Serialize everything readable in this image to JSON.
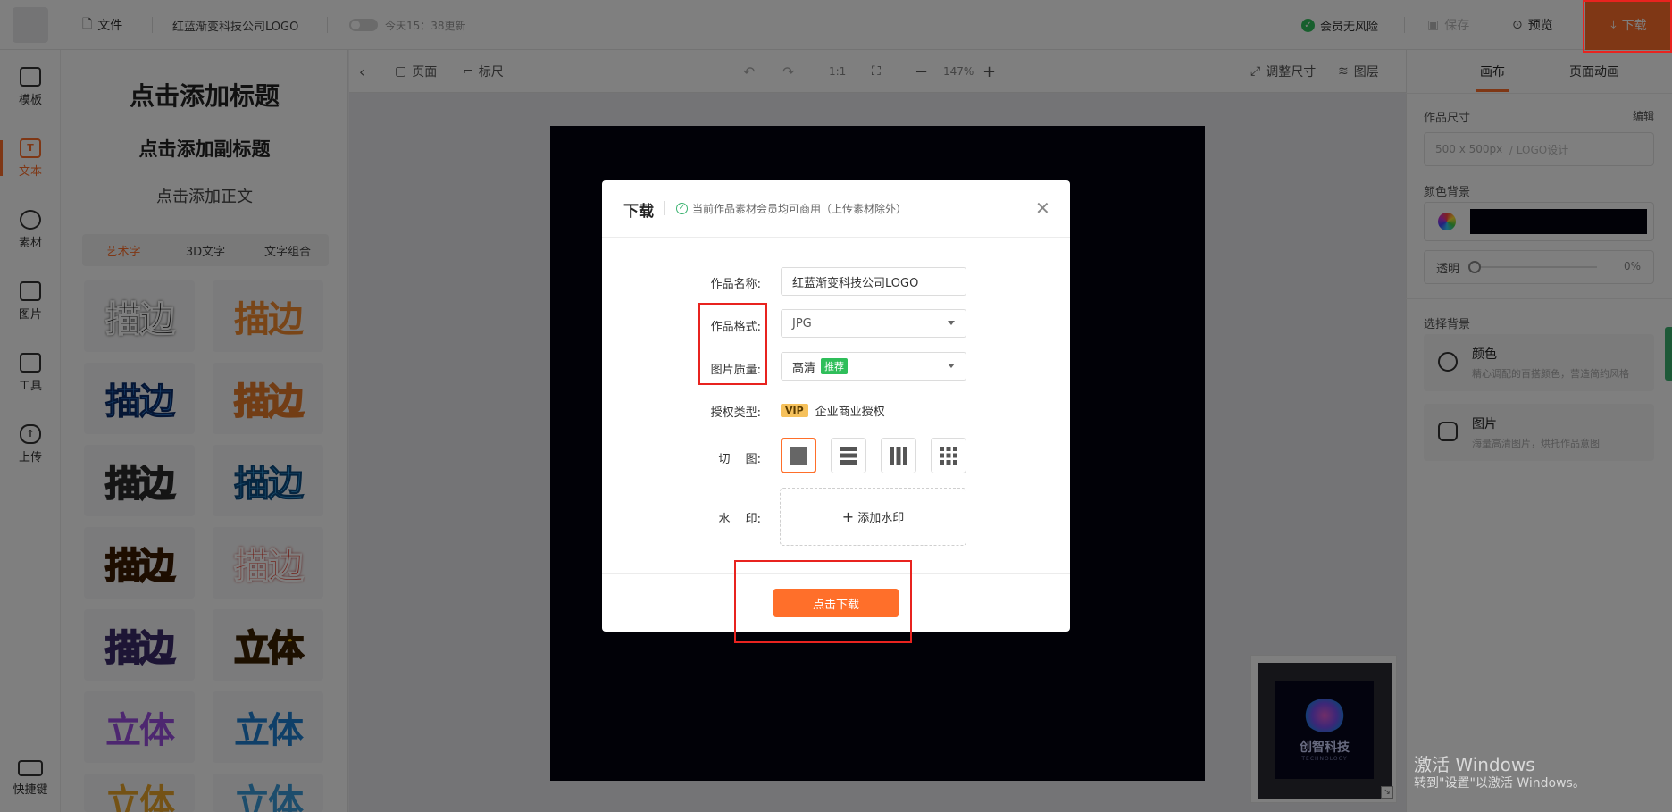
{
  "header": {
    "file_label": "文件",
    "doc_title": "红蓝渐变科技公司LOGO",
    "update_time": "今天15：38更新",
    "member_status": "会员无风险",
    "save_label": "保存",
    "preview_label": "预览",
    "download_label": "下载"
  },
  "rail": {
    "items": [
      {
        "label": "模板",
        "icon": "shirt-icon"
      },
      {
        "label": "文本",
        "icon": "text-icon"
      },
      {
        "label": "素材",
        "icon": "shapes-icon"
      },
      {
        "label": "图片",
        "icon": "image-icon"
      },
      {
        "label": "工具",
        "icon": "toolbox-icon"
      },
      {
        "label": "上传",
        "icon": "cloud-upload-icon"
      }
    ],
    "shortcut_label": "快捷键"
  },
  "text_panel": {
    "add_title": "点击添加标题",
    "add_subtitle": "点击添加副标题",
    "add_body": "点击添加正文",
    "tabs": [
      "艺术字",
      "3D文字",
      "文字组合"
    ],
    "samples": [
      "描边",
      "描边",
      "描边",
      "描边",
      "描边",
      "描边",
      "描边",
      "描边",
      "描边",
      "立体",
      "立体",
      "立体",
      "立体",
      "立体"
    ]
  },
  "canvas_toolbar": {
    "page_label": "页面",
    "ruler_label": "标尺",
    "ratio_label": "1:1",
    "zoom_value": "147%",
    "resize_label": "调整尺寸",
    "layers_label": "图层"
  },
  "right_panel": {
    "tabs": [
      "画布",
      "页面动画"
    ],
    "size_label": "作品尺寸",
    "edit_label": "编辑",
    "size_value": "500 x 500px",
    "size_type": "/ LOGO设计",
    "color_bg_label": "颜色背景",
    "bg_color": "#03030f",
    "opacity_label": "透明",
    "opacity_value": "0%",
    "choose_bg_label": "选择背景",
    "bg_options": [
      {
        "title": "颜色",
        "desc": "精心调配的百搭颜色，营造简约风格"
      },
      {
        "title": "图片",
        "desc": "海量高清图片，烘托作品意图"
      }
    ]
  },
  "thumbnail": {
    "logo_text": "创智科技",
    "logo_sub": "TECHNOLOGY"
  },
  "modal": {
    "title": "下载",
    "note": "当前作品素材会员均可商用（上传素材除外）",
    "name_label": "作品名称:",
    "name_value": "红蓝渐变科技公司LOGO",
    "format_label": "作品格式:",
    "format_value": "JPG",
    "quality_label": "图片质量:",
    "quality_value": "高清",
    "quality_badge": "推荐",
    "license_label": "授权类型:",
    "license_badge": "VIP",
    "license_value": "企业商业授权",
    "cut_label": "切　 图:",
    "watermark_label": "水　 印:",
    "watermark_add": "添加水印",
    "download_button": "点击下载"
  },
  "os": {
    "activate_title": "激活 Windows",
    "activate_desc": "转到\"设置\"以激活 Windows。"
  },
  "colors": {
    "accent": "#ff6f2a",
    "highlight": "#e8231f"
  }
}
